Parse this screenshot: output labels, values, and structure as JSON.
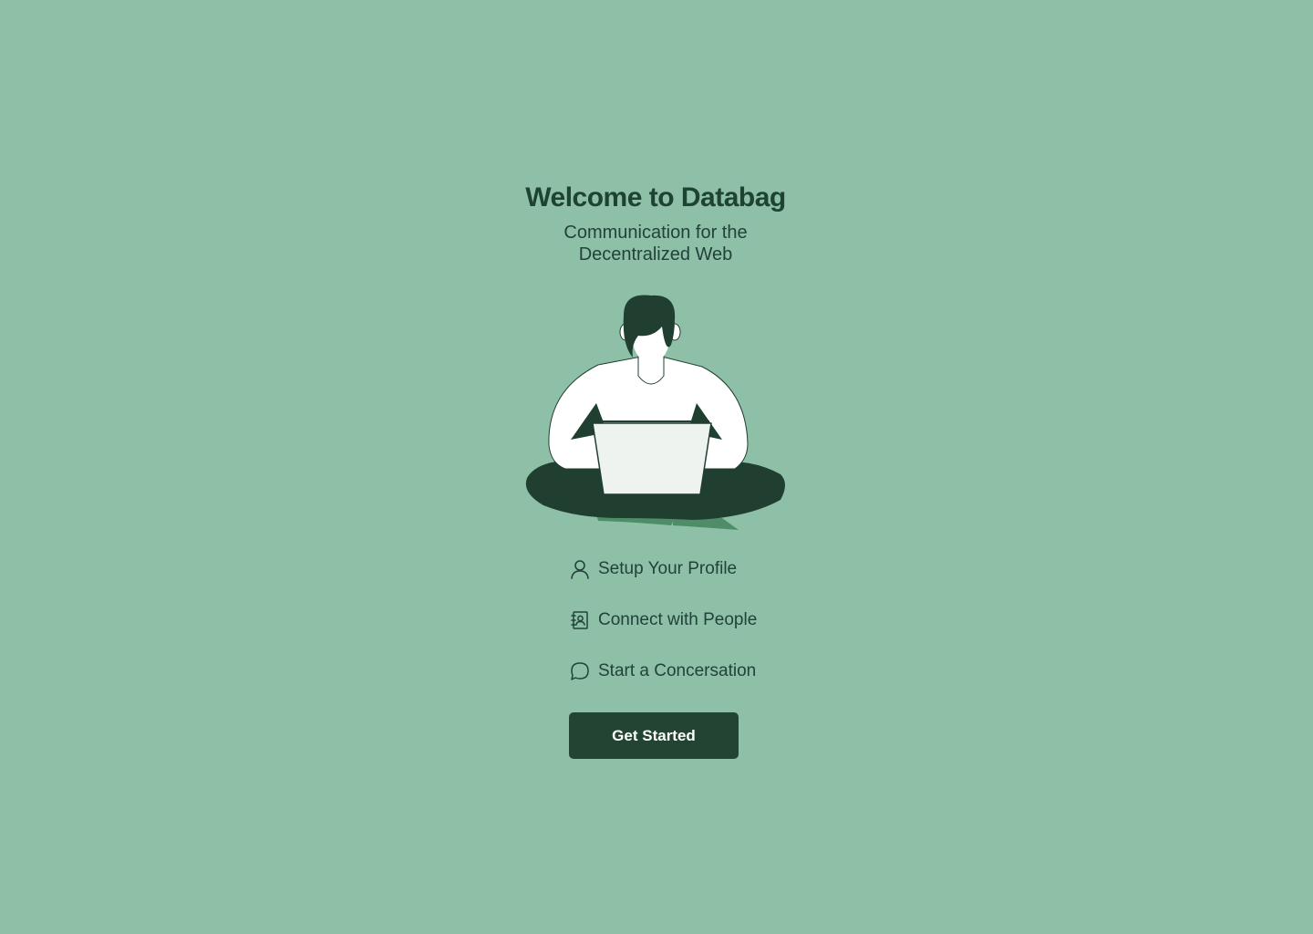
{
  "welcome": {
    "title": "Welcome to Databag",
    "subtitle_line1": "Communication for the",
    "subtitle_line2": "Decentralized Web"
  },
  "features": [
    {
      "label": "Setup Your Profile",
      "icon": "user-icon"
    },
    {
      "label": "Connect with People",
      "icon": "contact-book-icon"
    },
    {
      "label": "Start a Concersation",
      "icon": "chat-bubble-icon"
    }
  ],
  "cta": {
    "label": "Get Started"
  },
  "colors": {
    "background": "#8ebfa7",
    "primary_dark": "#234432",
    "accent_green": "#4f8d68"
  }
}
